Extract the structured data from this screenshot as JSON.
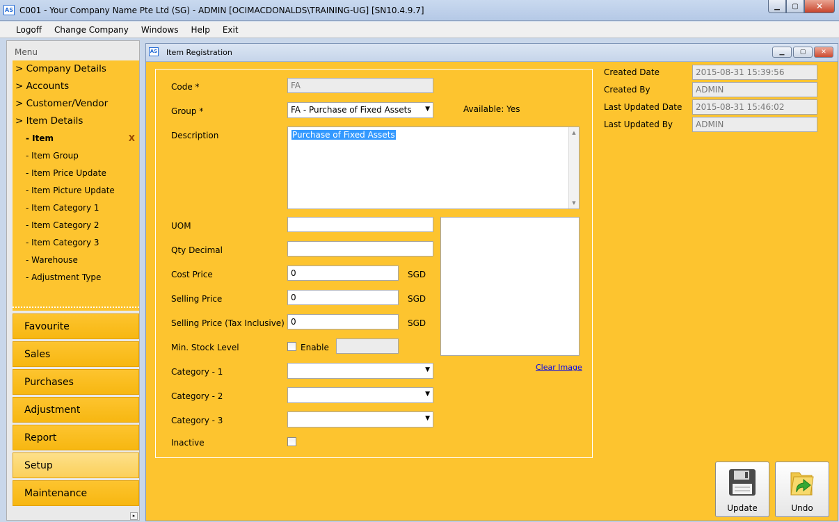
{
  "window": {
    "app_icon": "AS",
    "title": "C001 - Your Company Name Pte Ltd (SG) - ADMIN [OCIMACDONALDS\\TRAINING-UG] [SN10.4.9.7]",
    "min": "▁",
    "max": "▢",
    "close": "✕"
  },
  "menubar": [
    "Logoff",
    "Change Company",
    "Windows",
    "Help",
    "Exit"
  ],
  "sidebar": {
    "heading": "Menu",
    "tree": [
      {
        "label": "> Company Details"
      },
      {
        "label": "> Accounts"
      },
      {
        "label": "> Customer/Vendor"
      },
      {
        "label": "> Item Details"
      }
    ],
    "children": [
      {
        "label": "- Item",
        "active": true
      },
      {
        "label": "- Item Group"
      },
      {
        "label": "- Item Price Update"
      },
      {
        "label": "- Item Picture Update"
      },
      {
        "label": "- Item Category 1"
      },
      {
        "label": "- Item Category 2"
      },
      {
        "label": "- Item Category 3"
      },
      {
        "label": "- Warehouse"
      },
      {
        "label": "- Adjustment Type"
      }
    ],
    "close_mark": "X",
    "nav": [
      {
        "label": "Favourite"
      },
      {
        "label": "Sales"
      },
      {
        "label": "Purchases"
      },
      {
        "label": "Adjustment"
      },
      {
        "label": "Report"
      },
      {
        "label": "Setup",
        "active": true
      },
      {
        "label": "Maintenance"
      }
    ],
    "scroll_glyph": "▸"
  },
  "child": {
    "app_icon": "AS",
    "title": "Item Registration",
    "min": "▁",
    "max": "▢",
    "close": "✕"
  },
  "form": {
    "code_label": "Code *",
    "code_value": "FA",
    "group_label": "Group *",
    "group_value": "FA - Purchase of Fixed Assets",
    "available": "Available: Yes",
    "description_label": "Description",
    "description_value": "Purchase of Fixed Assets",
    "uom_label": "UOM",
    "uom_value": "",
    "qty_decimal_label": "Qty Decimal",
    "qty_decimal_value": "",
    "cost_price_label": "Cost Price",
    "cost_price_value": "0",
    "selling_price_label": "Selling Price",
    "selling_price_value": "0",
    "selling_price_tax_label": "Selling Price (Tax Inclusive)",
    "selling_price_tax_value": "0",
    "currency": "SGD",
    "min_stock_label": "Min. Stock Level",
    "enable_label": "Enable",
    "category1_label": "Category - 1",
    "category2_label": "Category - 2",
    "category3_label": "Category - 3",
    "inactive_label": "Inactive",
    "clear_image": "Clear Image",
    "dropdown_arrow": "▼"
  },
  "audit": {
    "created_date_label": "Created Date",
    "created_date_value": "2015-08-31 15:39:56",
    "created_by_label": "Created By",
    "created_by_value": "ADMIN",
    "last_updated_date_label": "Last Updated Date",
    "last_updated_date_value": "2015-08-31 15:46:02",
    "last_updated_by_label": "Last Updated By",
    "last_updated_by_value": "ADMIN"
  },
  "buttons": {
    "update": "Update",
    "undo": "Undo"
  },
  "colors": {
    "accent": "#fdc42f",
    "selection": "#3399ff"
  }
}
